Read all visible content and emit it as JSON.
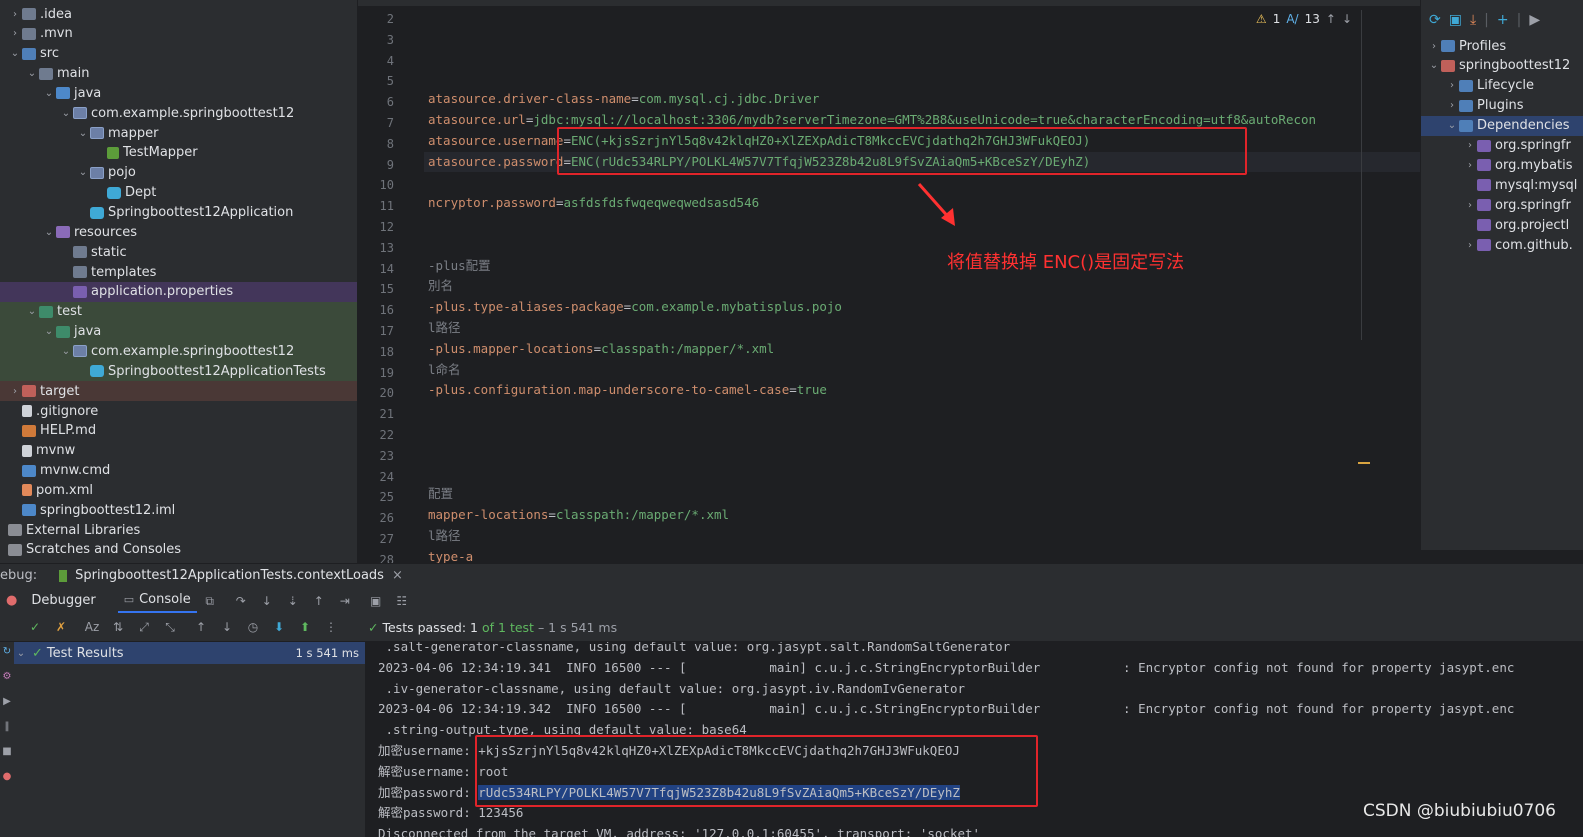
{
  "project_tree": [
    {
      "label": ".idea",
      "arrow": "›",
      "icon": "folder-icon"
    },
    {
      "label": ".mvn",
      "arrow": "›",
      "icon": "folder-icon"
    },
    {
      "label": "src",
      "arrow": "⌄",
      "icon": "source-folder-icon"
    },
    {
      "label": "main",
      "arrow": "⌄",
      "icon": "folder-icon"
    },
    {
      "label": "java",
      "arrow": "⌄",
      "icon": "java-folder-icon"
    },
    {
      "label": "com.example.springboottest12",
      "arrow": "⌄",
      "icon": "package-icon"
    },
    {
      "label": "mapper",
      "arrow": "⌄",
      "icon": "package-icon"
    },
    {
      "label": "TestMapper",
      "arrow": "",
      "icon": "mapper-icon"
    },
    {
      "label": "pojo",
      "arrow": "⌄",
      "icon": "package-icon"
    },
    {
      "label": "Dept",
      "arrow": "",
      "icon": "class-icon"
    },
    {
      "label": "Springboottest12Application",
      "arrow": "",
      "icon": "springboot-class-icon"
    },
    {
      "label": "resources",
      "arrow": "⌄",
      "icon": "resources-folder-icon"
    },
    {
      "label": "static",
      "arrow": "",
      "icon": "folder-icon"
    },
    {
      "label": "templates",
      "arrow": "",
      "icon": "folder-icon"
    },
    {
      "label": "application.properties",
      "arrow": "",
      "icon": "properties-file-icon"
    },
    {
      "label": "test",
      "arrow": "⌄",
      "icon": "test-folder-icon"
    },
    {
      "label": "java",
      "arrow": "⌄",
      "icon": "java-test-folder-icon"
    },
    {
      "label": "com.example.springboottest12",
      "arrow": "⌄",
      "icon": "package-icon"
    },
    {
      "label": "Springboottest12ApplicationTests",
      "arrow": "",
      "icon": "test-class-icon"
    },
    {
      "label": "target",
      "arrow": "›",
      "icon": "target-folder-icon"
    },
    {
      "label": ".gitignore",
      "arrow": "",
      "icon": "gitignore-icon"
    },
    {
      "label": "HELP.md",
      "arrow": "",
      "icon": "markdown-icon"
    },
    {
      "label": "mvnw",
      "arrow": "",
      "icon": "file-icon"
    },
    {
      "label": "mvnw.cmd",
      "arrow": "",
      "icon": "cmd-file-icon"
    },
    {
      "label": "pom.xml",
      "arrow": "",
      "icon": "maven-icon"
    },
    {
      "label": "springboottest12.iml",
      "arrow": "",
      "icon": "iml-file-icon"
    },
    {
      "label": "External Libraries",
      "arrow": "›",
      "icon": "library-icon"
    },
    {
      "label": "Scratches and Consoles",
      "arrow": "",
      "icon": "scratches-icon"
    }
  ],
  "editor": {
    "warnings": "1",
    "typos": "13",
    "lines": [
      {
        "n": "2",
        "text": ""
      },
      {
        "n": "3",
        "text": ""
      },
      {
        "n": "4",
        "text": ""
      },
      {
        "n": "5",
        "text": ""
      },
      {
        "n": "6",
        "key": "atasource.driver-class-name",
        "eq": "=",
        "val": "com.mysql.cj.jdbc.Driver"
      },
      {
        "n": "7",
        "key": "atasource.url",
        "eq": "=",
        "val": "jdbc:mysql://localhost:3306/mydb?serverTimezone=GMT%2B8&useUnicode=true&characterEncoding=utf8&autoRecon"
      },
      {
        "n": "8",
        "key": "atasource.username",
        "eq": "=",
        "val": "ENC(+kjsSzrjnYl5q8v42klqHZ0+XlZEXpAdicT8MkccEVCjdathq2h7GHJ3WFukQEOJ)"
      },
      {
        "n": "9",
        "key": "atasource.password",
        "eq": "=",
        "val": "ENC(rUdc534RLPY/POLKL4W57V7TfqjW523Z8b42u8L9fSvZAiaQm5+KBceSzY/DEyhZ)"
      },
      {
        "n": "10",
        "text": ""
      },
      {
        "n": "11",
        "key": "ncryptor.password",
        "eq": "=",
        "val": "asfdsfdsfwqeqweqwedsasd546"
      },
      {
        "n": "12",
        "text": ""
      },
      {
        "n": "13",
        "text": ""
      },
      {
        "n": "14",
        "comment": "-plus配置"
      },
      {
        "n": "15",
        "comment": "別名"
      },
      {
        "n": "16",
        "key": "-plus.type-aliases-package",
        "eq": "=",
        "val": "com.example.mybatisplus.pojo"
      },
      {
        "n": "17",
        "comment": "l路径"
      },
      {
        "n": "18",
        "key": "-plus.mapper-locations",
        "eq": "=",
        "val": "classpath:/mapper/*.xml"
      },
      {
        "n": "19",
        "comment": "l命名"
      },
      {
        "n": "20",
        "key": "-plus.configuration.map-underscore-to-camel-case",
        "eq": "=",
        "val": "true"
      },
      {
        "n": "21",
        "text": ""
      },
      {
        "n": "22",
        "text": ""
      },
      {
        "n": "23",
        "text": ""
      },
      {
        "n": "24",
        "text": ""
      },
      {
        "n": "25",
        "comment": "配置"
      },
      {
        "n": "26",
        "key": "mapper-locations",
        "eq": "=",
        "val": "classpath:/mapper/*.xml"
      },
      {
        "n": "27",
        "comment": "l路径"
      },
      {
        "n": "28",
        "key": "type-a",
        "eq": "",
        "val": ""
      }
    ]
  },
  "annotation": "将值替换掉 ENC()是固定写法",
  "maven": {
    "items": [
      {
        "label": "Profiles",
        "arrow": "›",
        "indent": 0
      },
      {
        "label": "springboottest12",
        "arrow": "⌄",
        "indent": 0
      },
      {
        "label": "Lifecycle",
        "arrow": "›",
        "indent": 1
      },
      {
        "label": "Plugins",
        "arrow": "›",
        "indent": 1
      },
      {
        "label": "Dependencies",
        "arrow": "⌄",
        "indent": 1
      },
      {
        "label": "org.springfr",
        "arrow": "›",
        "indent": 2
      },
      {
        "label": "org.mybatis",
        "arrow": "›",
        "indent": 2
      },
      {
        "label": "mysql:mysql",
        "arrow": "",
        "indent": 2
      },
      {
        "label": "org.springfr",
        "arrow": "›",
        "indent": 2
      },
      {
        "label": "org.projectl",
        "arrow": "",
        "indent": 2
      },
      {
        "label": "com.github.",
        "arrow": "›",
        "indent": 2
      }
    ]
  },
  "debug": {
    "label": "ebug:",
    "session": "Springboottest12ApplicationTests.contextLoads",
    "close": "×",
    "tab_debugger": "Debugger",
    "tab_console": "Console",
    "tests_passed_label": "Tests passed:",
    "tests_passed_count": "1",
    "tests_of": "of 1 test",
    "tests_time": "– 1 s 541 ms",
    "test_results": "Test Results",
    "test_results_time": "1 s 541 ms"
  },
  "console_lines": [
    " .salt-generator-classname, using default value: org.jasypt.salt.RandomSaltGenerator",
    "2023-04-06 12:34:19.341  INFO 16500 --- [           main] c.u.j.c.StringEncryptorBuilder           : Encryptor config not found for property jasypt.enc",
    " .iv-generator-classname, using default value: org.jasypt.iv.RandomIvGenerator",
    "2023-04-06 12:34:19.342  INFO 16500 --- [           main] c.u.j.c.StringEncryptorBuilder           : Encryptor config not found for property jasypt.enc",
    " .string-output-type, using default value: base64",
    "加密username: +kjsSzrjnYl5q8v42klqHZ0+XlZEXpAdicT8MkccEVCjdathq2h7GHJ3WFukQEOJ",
    "解密username: root",
    "加密password: ",
    "解密password: 123456",
    "Disconnected from the target VM, address: '127.0.0.1:60455', transport: 'socket'"
  ],
  "console_selected": "rUdc534RLPY/POLKL4W57V7TfqjW523Z8b42u8L9fSvZAiaQm5+KBceSzY/DEyhZ",
  "watermark": "CSDN @biubiubiu0706"
}
